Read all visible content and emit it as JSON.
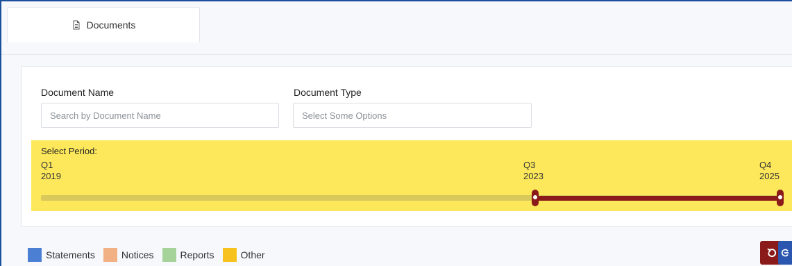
{
  "tabs": [
    {
      "label": "Documents",
      "icon": "document-icon"
    }
  ],
  "filters": {
    "document_name": {
      "label": "Document Name",
      "placeholder": "Search by Document Name"
    },
    "document_type": {
      "label": "Document Type",
      "placeholder": "Select Some Options"
    }
  },
  "period": {
    "label": "Select Period:",
    "start": {
      "quarter": "Q1",
      "year": "2019"
    },
    "selected_start": {
      "quarter": "Q3",
      "year": "2023"
    },
    "end": {
      "quarter": "Q4",
      "year": "2025"
    },
    "accent_color": "#8b1a1a",
    "background_color": "#fde85b"
  },
  "legend": [
    {
      "label": "Statements",
      "color": "#4a7fd4"
    },
    {
      "label": "Notices",
      "color": "#f2b085"
    },
    {
      "label": "Reports",
      "color": "#a6d39a"
    },
    {
      "label": "Other",
      "color": "#f7c21e"
    }
  ],
  "actions": {
    "reset_icon": "reset-icon",
    "blue_action_icon": "action-icon"
  }
}
